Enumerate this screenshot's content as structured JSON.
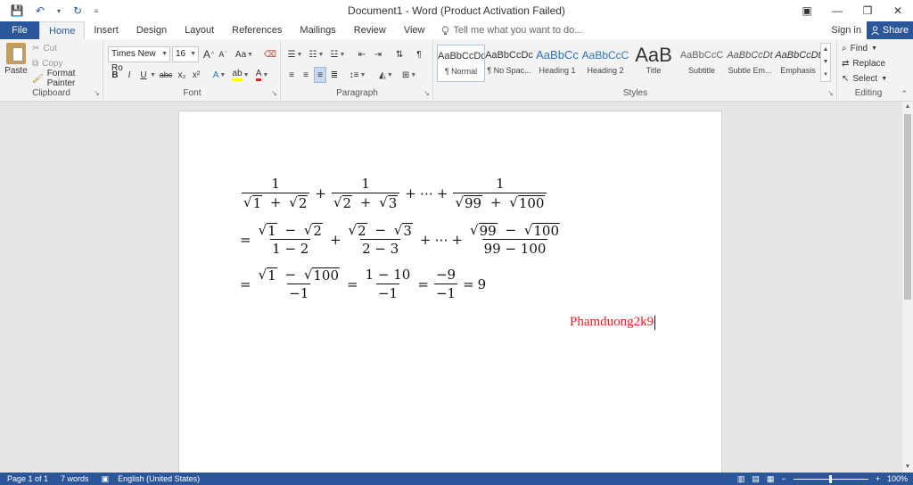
{
  "window": {
    "title": "Document1 - Word (Product Activation Failed)",
    "controls": {
      "ribbon_options": "▣",
      "minimize": "—",
      "restore": "❐",
      "close": "✕"
    }
  },
  "qat": {
    "save": "💾",
    "undo": "↶",
    "undo_dd": "▾",
    "redo": "↻",
    "customize": "≡"
  },
  "tabs": {
    "file": "File",
    "items": [
      "Home",
      "Insert",
      "Design",
      "Layout",
      "References",
      "Mailings",
      "Review",
      "View"
    ],
    "tell_me": "Tell me what you want to do...",
    "sign_in": "Sign in",
    "share": "Share"
  },
  "clipboard": {
    "paste": "Paste",
    "cut": "Cut",
    "copy": "Copy",
    "format_painter": "Format Painter",
    "label": "Clipboard"
  },
  "font": {
    "name": "Times New Ro",
    "size": "16",
    "grow": "A",
    "shrink": "A",
    "case": "Aa",
    "bold": "B",
    "italic": "I",
    "underline": "U",
    "strike": "abc",
    "subscript": "x₂",
    "superscript": "x²",
    "label": "Font"
  },
  "paragraph": {
    "label": "Paragraph",
    "pilcrow": "¶"
  },
  "styles": {
    "label": "Styles",
    "items": [
      {
        "sample": "AaBbCcDc",
        "name": "¶ Normal"
      },
      {
        "sample": "AaBbCcDc",
        "name": "¶ No Spac..."
      },
      {
        "sample": "AaBbCc",
        "name": "Heading 1"
      },
      {
        "sample": "AaBbCcC",
        "name": "Heading 2"
      },
      {
        "sample": "AaB",
        "name": "Title"
      },
      {
        "sample": "AaBbCcC",
        "name": "Subtitle"
      },
      {
        "sample": "AaBbCcDt",
        "name": "Subtle Em..."
      },
      {
        "sample": "AaBbCcDt",
        "name": "Emphasis"
      }
    ]
  },
  "editing": {
    "find": "Find",
    "replace": "Replace",
    "select": "Select",
    "label": "Editing"
  },
  "document": {
    "line1": {
      "t1_num": "1",
      "t1_a": "1",
      "t1_b": "2",
      "t2_num": "1",
      "t2_a": "2",
      "t2_b": "3",
      "t3_num": "1",
      "t3_a": "99",
      "t3_b": "100",
      "dots": "⋯"
    },
    "line2": {
      "t1_a": "1",
      "t1_b": "2",
      "t1_den": "1 − 2",
      "t2_a": "2",
      "t2_b": "3",
      "t2_den": "2 − 3",
      "t3_a": "99",
      "t3_b": "100",
      "t3_den": "99 − 100",
      "dots": "⋯"
    },
    "line3": {
      "f1_a": "1",
      "f1_b": "100",
      "f1_den": "−1",
      "f2_num": "1 − 10",
      "f2_den": "−1",
      "f3_num": "−9",
      "f3_den": "−1",
      "result": "9"
    },
    "signature": "Phamduong2k9",
    "signature_color": "#e81e1e"
  },
  "status": {
    "page": "Page 1 of 1",
    "words": "7 words",
    "language": "English (United States)",
    "zoom": "100%",
    "zoom_fraction": 0.5
  },
  "colors": {
    "accent": "#2b579a",
    "ribbon_bg": "#f3f3f3",
    "page_bg": "#ffffff"
  }
}
